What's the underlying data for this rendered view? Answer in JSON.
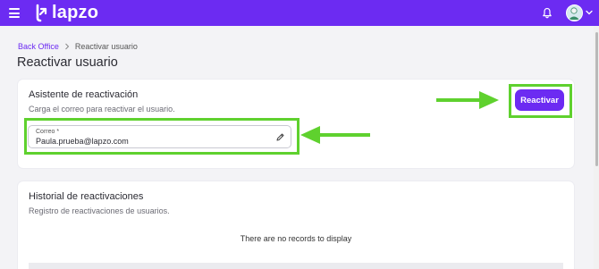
{
  "header": {
    "logo_text": "lapzo",
    "menu_icon": "hamburger-icon",
    "notification_icon": "bell-icon",
    "avatar_icon": "user-avatar",
    "brand_color": "#6c2bf2"
  },
  "breadcrumb": {
    "items": [
      "Back Office",
      "Reactivar usuario"
    ]
  },
  "page": {
    "title": "Reactivar usuario"
  },
  "reactivation": {
    "title": "Asistente de reactivación",
    "subtitle": "Carga el correo para reactivar el usuario.",
    "email_label": "Correo *",
    "email_value": "Paula.prueba@lapzo.com",
    "button_label": "Reactivar"
  },
  "history": {
    "title": "Historial de reactivaciones",
    "subtitle": "Registro de reactivaciones de usuarios.",
    "empty_message": "There are no records to display"
  },
  "annotations": {
    "highlight_color": "#5fd12e"
  }
}
